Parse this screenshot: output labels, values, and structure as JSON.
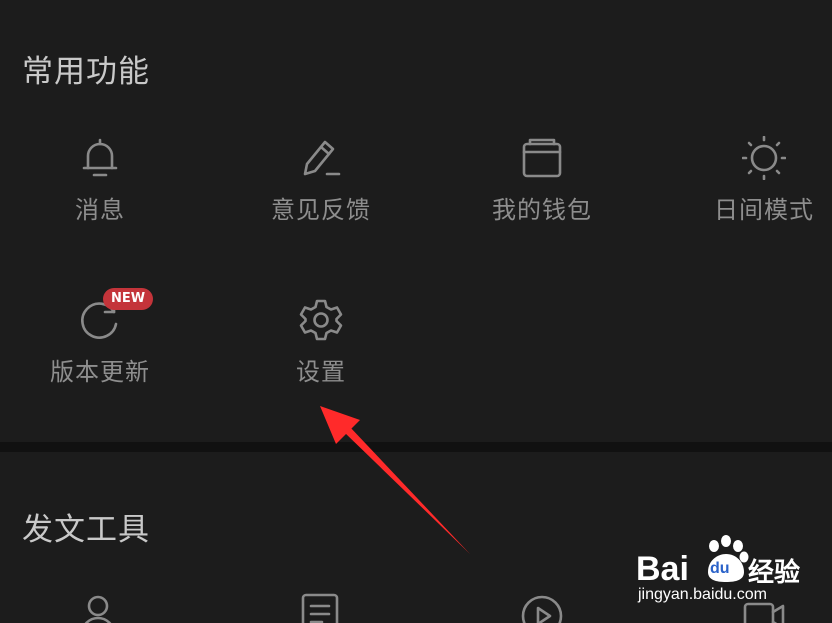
{
  "sections": [
    {
      "title": "常用功能",
      "items": [
        {
          "label": "消息",
          "icon": "bell-icon"
        },
        {
          "label": "意见反馈",
          "icon": "edit-pen-icon"
        },
        {
          "label": "我的钱包",
          "icon": "wallet-icon"
        },
        {
          "label": "日间模式",
          "icon": "sun-icon"
        },
        {
          "label": "版本更新",
          "icon": "refresh-icon",
          "badge": "NEW"
        },
        {
          "label": "设置",
          "icon": "gear-icon"
        }
      ]
    },
    {
      "title": "发文工具",
      "items": [
        {
          "icon": "user-icon"
        },
        {
          "icon": "document-icon"
        },
        {
          "icon": "play-icon"
        },
        {
          "icon": "video-camera-icon"
        }
      ]
    }
  ],
  "colors": {
    "background": "#1c1c1c",
    "divider": "#111111",
    "title_text": "#c9c9c9",
    "label_text": "#8e8e8e",
    "icon_stroke": "#8a8a8a",
    "badge": "#c4343a",
    "annotation_arrow": "#ff2a2a"
  },
  "watermark": {
    "brand": "Bai",
    "brand_du": "du",
    "product": "经验",
    "url": "jingyan.baidu.com"
  }
}
